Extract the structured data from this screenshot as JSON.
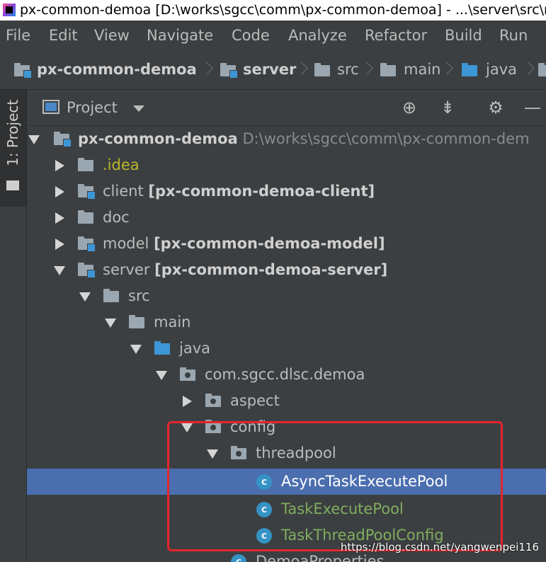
{
  "window": {
    "title": "px-common-demoa [D:\\works\\sgcc\\comm\\px-common-demoa] - ...\\server\\src\\ma"
  },
  "menu": {
    "items": [
      "File",
      "Edit",
      "View",
      "Navigate",
      "Code",
      "Analyze",
      "Refactor",
      "Build",
      "Run"
    ]
  },
  "breadcrumb": {
    "items": [
      "px-common-demoa",
      "server",
      "src",
      "main",
      "java"
    ]
  },
  "toolwindow": {
    "tab_label": "1: Project"
  },
  "project_panel": {
    "title": "Project",
    "buttons": {
      "locate_icon": "crosshair-icon",
      "collapse_icon": "collapse-all-icon",
      "settings_icon": "gear-icon",
      "hide_icon": "minimize-icon"
    }
  },
  "tree": {
    "root": {
      "name": "px-common-demoa",
      "path": "D:\\works\\sgcc\\comm\\px-common-dem"
    },
    "idea": ".idea",
    "client": {
      "name": "client",
      "module": "[px-common-demoa-client]"
    },
    "doc": "doc",
    "model": {
      "name": "model",
      "module": "[px-common-demoa-model]"
    },
    "server": {
      "name": "server",
      "module": "[px-common-demoa-server]"
    },
    "src": "src",
    "main": "main",
    "java": "java",
    "package": "com.sgcc.dlsc.demoa",
    "aspect": "aspect",
    "config": "config",
    "threadpool": "threadpool",
    "classes": [
      "AsyncTaskExecutePool",
      "TaskExecutePool",
      "TaskThreadPoolConfig",
      "DemoaProperties"
    ],
    "class_icon_letter": "c"
  },
  "watermark": "https://blog.csdn.net/yangwenpei116",
  "colors": {
    "background": "#3c3f41",
    "selection": "#4b6eaf",
    "highlight_box": "#e3262d",
    "class_icon": "#3592c4",
    "new_file_green": "#7fae5f"
  }
}
